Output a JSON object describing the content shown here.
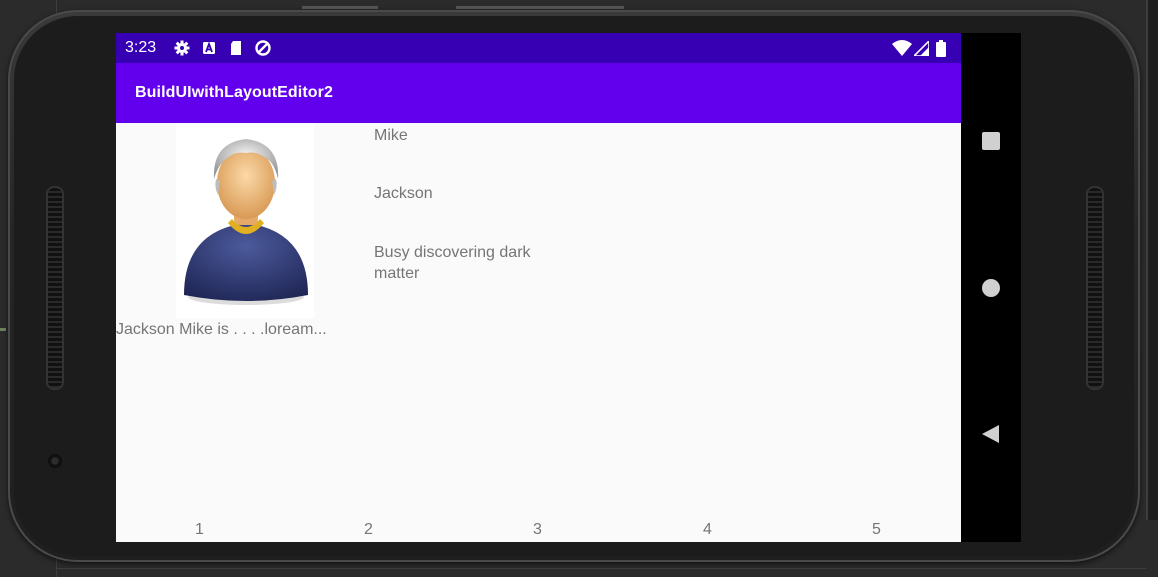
{
  "status_bar": {
    "time": "3:23",
    "left_icons": [
      "settings-gear-icon",
      "a-box-icon",
      "sd-card-icon",
      "data-saver-icon"
    ],
    "right_icons": [
      "wifi-icon",
      "signal-icon",
      "battery-icon"
    ]
  },
  "app_bar": {
    "title": "BuildUIwithLayoutEditor2"
  },
  "profile": {
    "avatar_icon": "user-avatar-icon",
    "caption": "Jackson Mike is . . . .loream...",
    "first_name": "Mike",
    "last_name": "Jackson",
    "bio": "Busy discovering dark matter"
  },
  "bottom_row": [
    "1",
    "2",
    "3",
    "4",
    "5"
  ],
  "nav_bar": {
    "buttons": [
      "overview-square-icon",
      "home-circle-icon",
      "back-triangle-icon"
    ]
  },
  "colors": {
    "status_bar": "#3700b3",
    "app_bar": "#6200ee",
    "screen_bg": "#fafafa",
    "text_secondary": "#757575"
  }
}
